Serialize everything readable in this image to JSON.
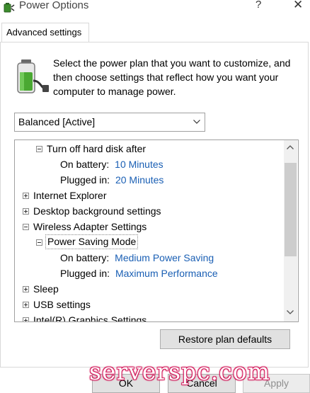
{
  "window": {
    "title": "Power Options",
    "help_glyph": "?",
    "close_glyph": "✕"
  },
  "tab": {
    "label": "Advanced settings"
  },
  "intro_text": "Select the power plan that you want to customize, and then choose settings that reflect how you want your computer to manage power.",
  "plan_select": {
    "value": "Balanced [Active]"
  },
  "tree": {
    "items": [
      {
        "label": "Turn off hard disk after",
        "expander": "minus"
      },
      {
        "label": "On battery:",
        "value": "10 Minutes"
      },
      {
        "label": "Plugged in:",
        "value": "20 Minutes"
      },
      {
        "label": "Internet Explorer",
        "expander": "plus"
      },
      {
        "label": "Desktop background settings",
        "expander": "plus"
      },
      {
        "label": "Wireless Adapter Settings",
        "expander": "minus"
      },
      {
        "label": "Power Saving Mode",
        "expander": "minus",
        "selected": true
      },
      {
        "label": "On battery:",
        "value": "Medium Power Saving"
      },
      {
        "label": "Plugged in:",
        "value": "Maximum Performance"
      },
      {
        "label": "Sleep",
        "expander": "plus"
      },
      {
        "label": "USB settings",
        "expander": "plus"
      },
      {
        "label": "Intel(R) Graphics Settings",
        "expander": "plus"
      }
    ]
  },
  "buttons": {
    "restore": "Restore plan defaults",
    "ok": "OK",
    "cancel": "Cancel",
    "apply": "Apply"
  },
  "watermark": "serverspc.com",
  "icons": {
    "app": "battery-plug-icon",
    "battery": "battery-icon",
    "dropdown": "chevron-down-icon",
    "scroll_up": "chevron-up-icon",
    "scroll_down": "chevron-down-icon"
  },
  "colors": {
    "value_link": "#1a5fb4",
    "watermark": "#d3195a"
  }
}
